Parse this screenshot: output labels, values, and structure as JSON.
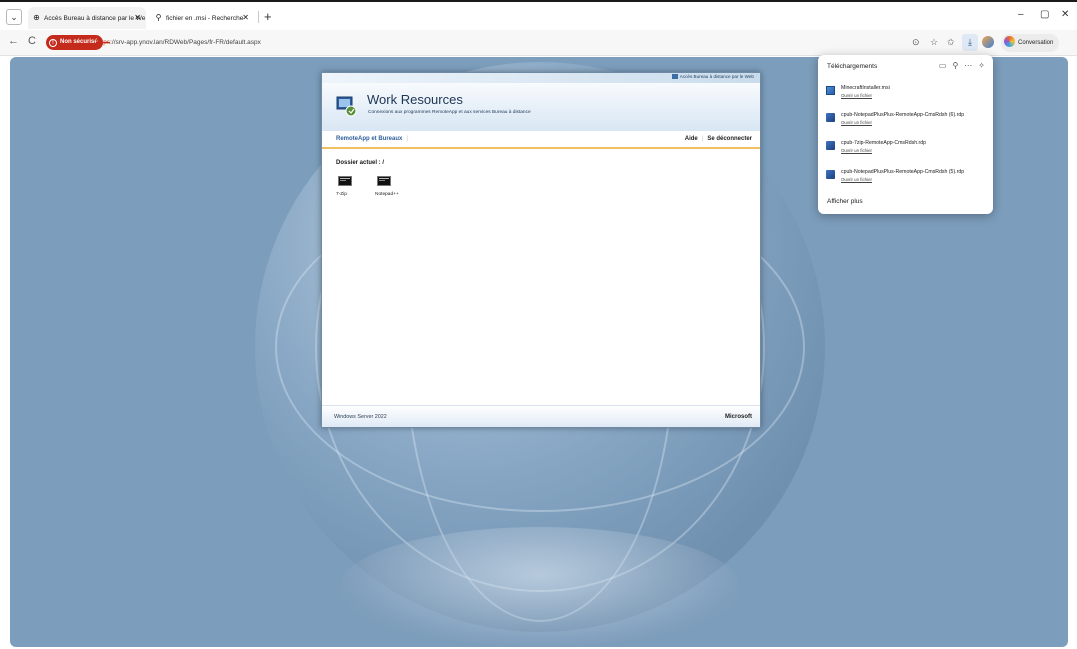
{
  "browser": {
    "tabs": [
      {
        "label": "Accès Bureau à distance par le We",
        "active": true
      },
      {
        "label": "fichier en .msi - Recherche",
        "active": false
      }
    ],
    "tab_close": "✕",
    "new_tab": "+",
    "window_controls": {
      "minimize": "–",
      "restore": "▢",
      "close": "✕"
    },
    "nav": {
      "back": "←",
      "refresh": "C"
    },
    "security_badge": "Non sécurisé",
    "url_protocol": "https",
    "url_rest": "://srv-app.ynov.lan/RDWeb/Pages/fr-FR/default.aspx",
    "toolbar_icons": [
      "reader-icon",
      "favorite-icon",
      "favorites-icon",
      "download-icon",
      "profile-icon",
      "more-icon"
    ],
    "copilot_label": "Conversation"
  },
  "rdweb": {
    "top_link": "Accès Bureau à distance par le Web",
    "title": "Work Resources",
    "subtitle": "Connexions aux programmes RemoteApp et aux services Bureau à distance",
    "nav_left": "RemoteApp et Bureaux",
    "nav_sep": "|",
    "help": "Aide",
    "logout": "Se déconnecter",
    "current_folder": "Dossier actuel : /",
    "apps": [
      {
        "label": "7-Zip"
      },
      {
        "label": "Notepad++"
      }
    ],
    "footer_left": "Windows Server 2022",
    "footer_right": "Microsoft"
  },
  "downloads": {
    "title": "Téléchargements",
    "open_file_label": "Ouvrir un fichier",
    "items": [
      {
        "name": "MinecraftInstaller.msi",
        "type": "msi"
      },
      {
        "name": "cpub-NotepadPlusPlus-RemoteApp-CmsRdsh (6).rdp",
        "type": "rdp"
      },
      {
        "name": "cpub-7zip-RemoteApp-CmsRdsh.rdp",
        "type": "rdp"
      },
      {
        "name": "cpub-NotepadPlusPlus-RemoteApp-CmsRdsh (5).rdp",
        "type": "rdp"
      }
    ],
    "show_more": "Afficher plus"
  },
  "colors": {
    "security_red": "#c42b1c",
    "viewport_blue": "#7c9dbc",
    "rd_link_blue": "#2e5f9b",
    "rd_accent": "#f0c060"
  }
}
